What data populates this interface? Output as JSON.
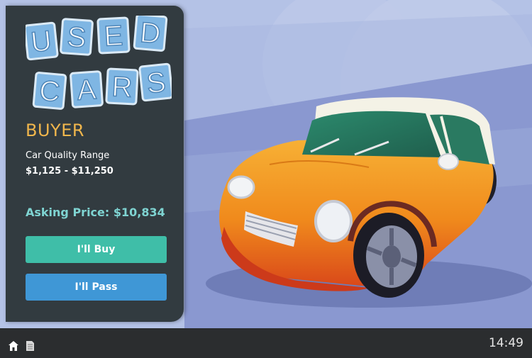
{
  "logo": {
    "line1": [
      "U",
      "S",
      "E",
      "D"
    ],
    "line2": [
      "C",
      "A",
      "R",
      "S"
    ]
  },
  "buyer_panel": {
    "role_label": "BUYER",
    "quality_range_label": "Car Quality Range",
    "quality_range_value": "$1,125 - $11,250",
    "asking_price_text": "Asking Price: $10,834",
    "buy_button_label": "I'll Buy",
    "pass_button_label": "I'll Pass"
  },
  "taskbar": {
    "clock": "14:49",
    "icons": [
      "home-icon",
      "document-icon"
    ]
  },
  "colors": {
    "panel_bg": "#323b40",
    "role_text": "#f0b64c",
    "asking_price_text": "#7fd4d2",
    "buy_button": "#3fbea8",
    "pass_button": "#3f97d6",
    "scene_bg": "#b5c3e6",
    "car_body": "#f29a1e",
    "car_roof": "#2d8466"
  }
}
